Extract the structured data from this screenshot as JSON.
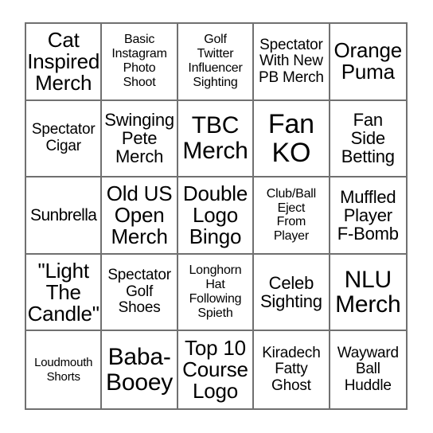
{
  "card": {
    "type": "bingo-card",
    "grid": {
      "rows": 5,
      "columns": 5
    },
    "colors": {
      "page_background": "#ffffff",
      "cell_background": "#ffffff",
      "grid_line": "#707070",
      "text": "#000000"
    },
    "cells": [
      {
        "id": "r1c1",
        "text": "Cat\nInspired\nMerch",
        "size": "lg"
      },
      {
        "id": "r1c2",
        "text": "Basic\nInstagram\nPhoto\nShoot",
        "size": "xs"
      },
      {
        "id": "r1c3",
        "text": "Golf\nTwitter\nInfluencer\nSighting",
        "size": "xs"
      },
      {
        "id": "r1c4",
        "text": "Spectator\nWith New\nPB Merch",
        "size": "sm"
      },
      {
        "id": "r1c5",
        "text": "Orange\nPuma",
        "size": "lg"
      },
      {
        "id": "r2c1",
        "text": "Spectator\nCigar",
        "size": "sm"
      },
      {
        "id": "r2c2",
        "text": "Swinging\nPete\nMerch",
        "size": "md"
      },
      {
        "id": "r2c3",
        "text": "TBC\nMerch",
        "size": "xl"
      },
      {
        "id": "r2c4",
        "text": "Fan\nKO",
        "size": "xxl"
      },
      {
        "id": "r2c5",
        "text": "Fan\nSide\nBetting",
        "size": "md"
      },
      {
        "id": "r3c1",
        "text": "Sunbrella",
        "size": "wide"
      },
      {
        "id": "r3c2",
        "text": "Old US\nOpen\nMerch",
        "size": "lg"
      },
      {
        "id": "r3c3",
        "text": "Double\nLogo\nBingo",
        "size": "lg"
      },
      {
        "id": "r3c4",
        "text": "Club/Ball\nEject\nFrom\nPlayer",
        "size": "xs"
      },
      {
        "id": "r3c5",
        "text": "Muffled\nPlayer\nF-Bomb",
        "size": "md"
      },
      {
        "id": "r4c1",
        "text": "\"Light\nThe\nCandle\"",
        "size": "lg"
      },
      {
        "id": "r4c2",
        "text": "Spectator\nGolf\nShoes",
        "size": "sm"
      },
      {
        "id": "r4c3",
        "text": "Longhorn\nHat\nFollowing\nSpieth",
        "size": "xs"
      },
      {
        "id": "r4c4",
        "text": "Celeb\nSighting",
        "size": "md"
      },
      {
        "id": "r4c5",
        "text": "NLU\nMerch",
        "size": "xl"
      },
      {
        "id": "r5c1",
        "text": "Loudmouth\nShorts",
        "size": "xxs"
      },
      {
        "id": "r5c2",
        "text": "Baba-\nBooey",
        "size": "xl"
      },
      {
        "id": "r5c3",
        "text": "Top 10\nCourse\nLogo",
        "size": "lg"
      },
      {
        "id": "r5c4",
        "text": "Kiradech\nFatty\nGhost",
        "size": "sm"
      },
      {
        "id": "r5c5",
        "text": "Wayward\nBall\nHuddle",
        "size": "sm"
      }
    ]
  }
}
